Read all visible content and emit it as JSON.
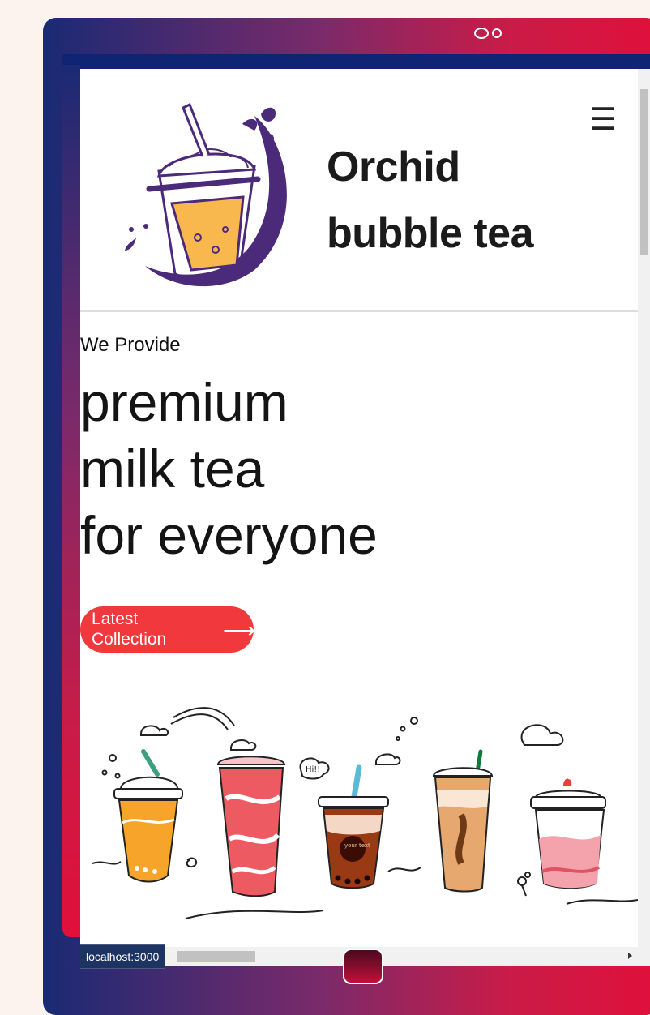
{
  "device": {
    "status_url": "localhost:3000"
  },
  "site": {
    "brand_line1": "Orchid",
    "brand_line2": "bubble tea",
    "menu_icon": "hamburger-icon"
  },
  "hero": {
    "eyebrow": "We Provide",
    "headline": [
      "premium",
      "milk tea",
      "for everyone"
    ],
    "cta_label": "Latest Collection",
    "cta_icon": "arrow-right-icon"
  },
  "colors": {
    "accent": "#f0383d",
    "logo_purple": "#4b2a7a",
    "frame_start": "#1a2a74",
    "frame_end": "#e0103a"
  },
  "illustration": {
    "name": "bubble-tea-cups-illustration",
    "cup_note": "Hi!!",
    "cup_label": "your text"
  }
}
